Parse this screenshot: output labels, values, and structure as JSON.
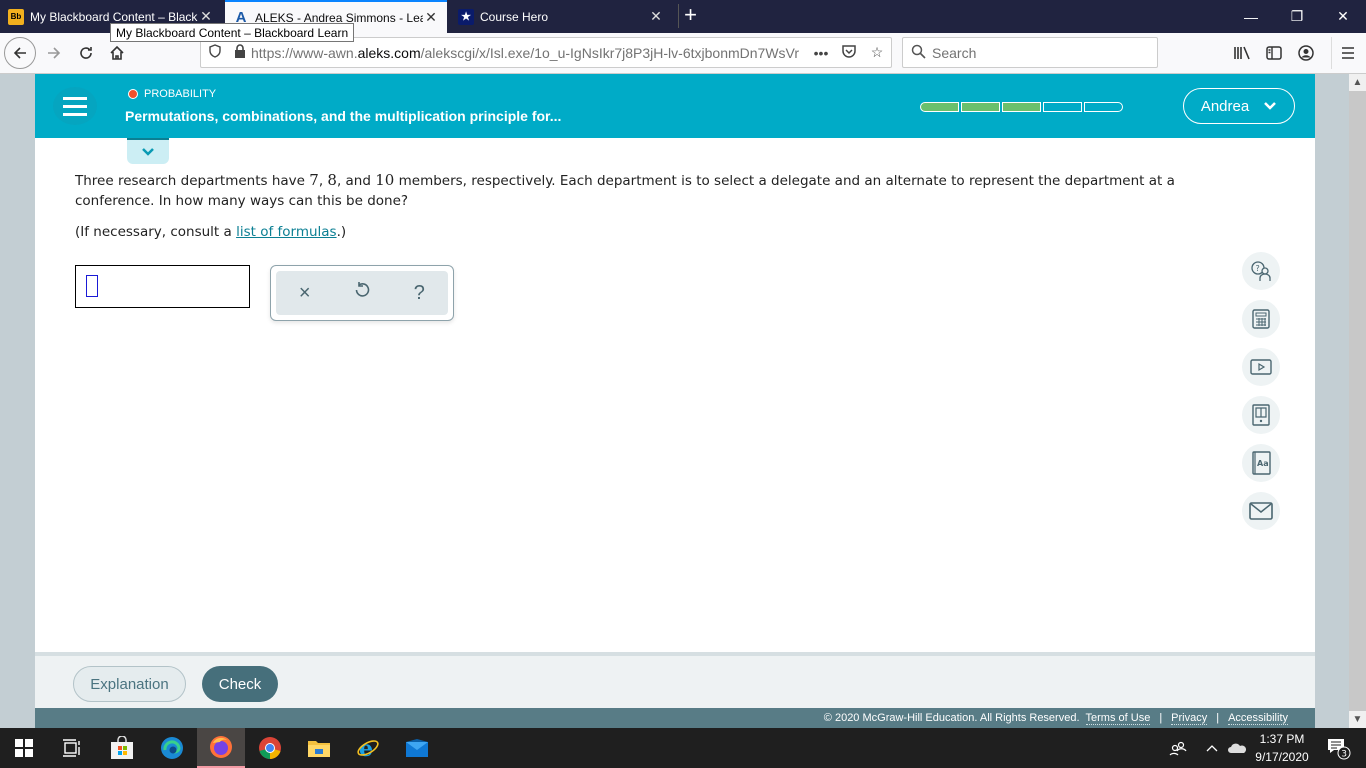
{
  "browser": {
    "tabs": [
      {
        "favicon": "blackboard-icon",
        "favicon_text": "Bb",
        "title": "My Blackboard Content – Black",
        "active": false
      },
      {
        "favicon": "aleks-icon",
        "favicon_text": "A",
        "title": "ALEKS - Andrea Simmons - Lea",
        "active": true
      },
      {
        "favicon": "course-hero-icon",
        "favicon_text": "★",
        "title": "Course Hero",
        "active": false
      }
    ],
    "tooltip": "My Blackboard Content – Blackboard Learn",
    "url_prefix": "https://www-awn.",
    "url_domain": "aleks.com",
    "url_path": "/alekscgi/x/Isl.exe/1o_u-IgNsIkr7j8P3jH-lv-6txjbonmDn7WsVr",
    "search_placeholder": "Search"
  },
  "aleks": {
    "topic": "PROBABILITY",
    "topic_status_color": "#f0502c",
    "lesson_title": "Permutations, combinations, and the multiplication principle for...",
    "progress": {
      "filled": 3,
      "total": 5
    },
    "user_name": "Andrea",
    "question": {
      "part1": "Three research departments have ",
      "n1": "7",
      "sep1": ", ",
      "n2": "8",
      "sep2": ", and ",
      "n3": "10",
      "part2": " members, respectively. Each department is to select a delegate and an alternate to represent the department at a conference. In how many ways can this be done?"
    },
    "hint_prefix": "(If necessary, consult a ",
    "hint_link": "list of formulas",
    "hint_suffix": ".)",
    "answer_value": "",
    "palette": {
      "clear": "×",
      "undo": "↺",
      "help": "?"
    },
    "side_tools": [
      "ask-instructor-icon",
      "calculator-icon",
      "video-icon",
      "ebook-icon",
      "dictionary-icon",
      "message-icon"
    ],
    "buttons": {
      "explanation": "Explanation",
      "check": "Check"
    },
    "footer": {
      "copyright": "© 2020 McGraw-Hill Education. All Rights Reserved.",
      "links": [
        "Terms of Use",
        "Privacy",
        "Accessibility"
      ]
    }
  },
  "taskbar": {
    "apps": [
      "windows-start-icon",
      "task-view-icon",
      "microsoft-store-icon",
      "edge-icon",
      "firefox-icon",
      "chrome-icon",
      "file-explorer-icon",
      "internet-explorer-icon",
      "mail-icon"
    ],
    "active_app": "firefox-icon",
    "time": "1:37 PM",
    "date": "9/17/2020",
    "notifications": "3"
  }
}
